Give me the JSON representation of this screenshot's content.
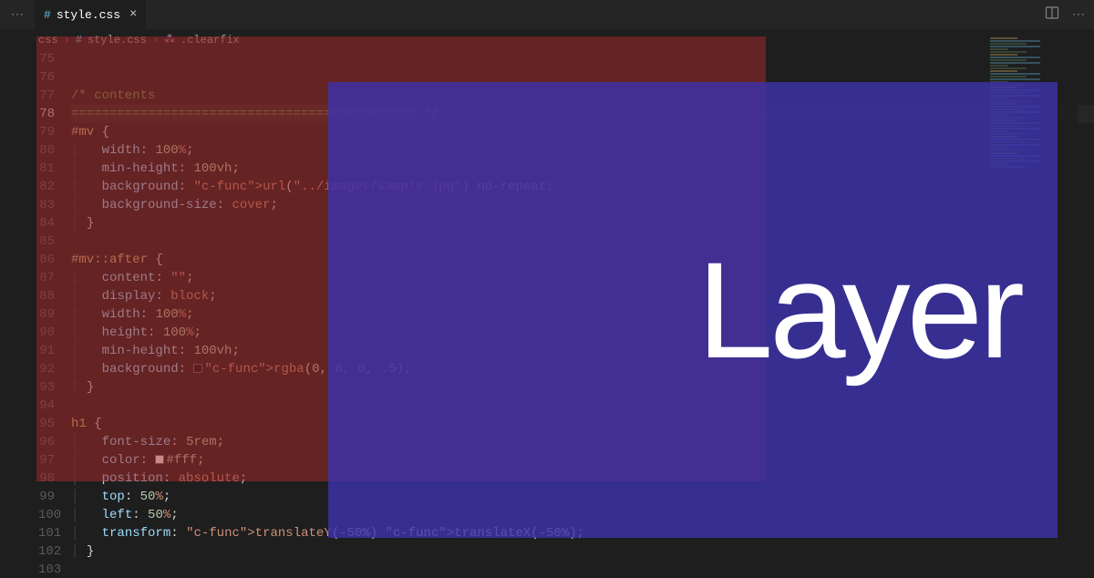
{
  "tab": {
    "icon": "#",
    "filename": "style.css"
  },
  "breadcrumb": {
    "folder": "css",
    "file": "style.css",
    "selector": ".clearfix"
  },
  "line_start": 75,
  "line_end": 103,
  "highlighted_line": 78,
  "code_lines": [
    "",
    "",
    "/* contents",
    "============================================= */",
    "#mv {",
    "  width: 100%;",
    "  min-height: 100vh;",
    "  background: url(\"../images/sample.jpg\") no-repeat;",
    "  background-size: cover;",
    "}",
    "",
    "#mv::after {",
    "  content: \"\";",
    "  display: block;",
    "  width: 100%;",
    "  height: 100%;",
    "  min-height: 100vh;",
    "  background: rgba(0, 0, 0, .5);",
    "}",
    "",
    "h1 {",
    "  font-size: 5rem;",
    "  color: #fff;",
    "  position: absolute;",
    "  top: 50%;",
    "  left: 50%;",
    "  transform: translateY(-50%) translateX(-50%);",
    "}",
    ""
  ],
  "overlay_label": "Layer"
}
